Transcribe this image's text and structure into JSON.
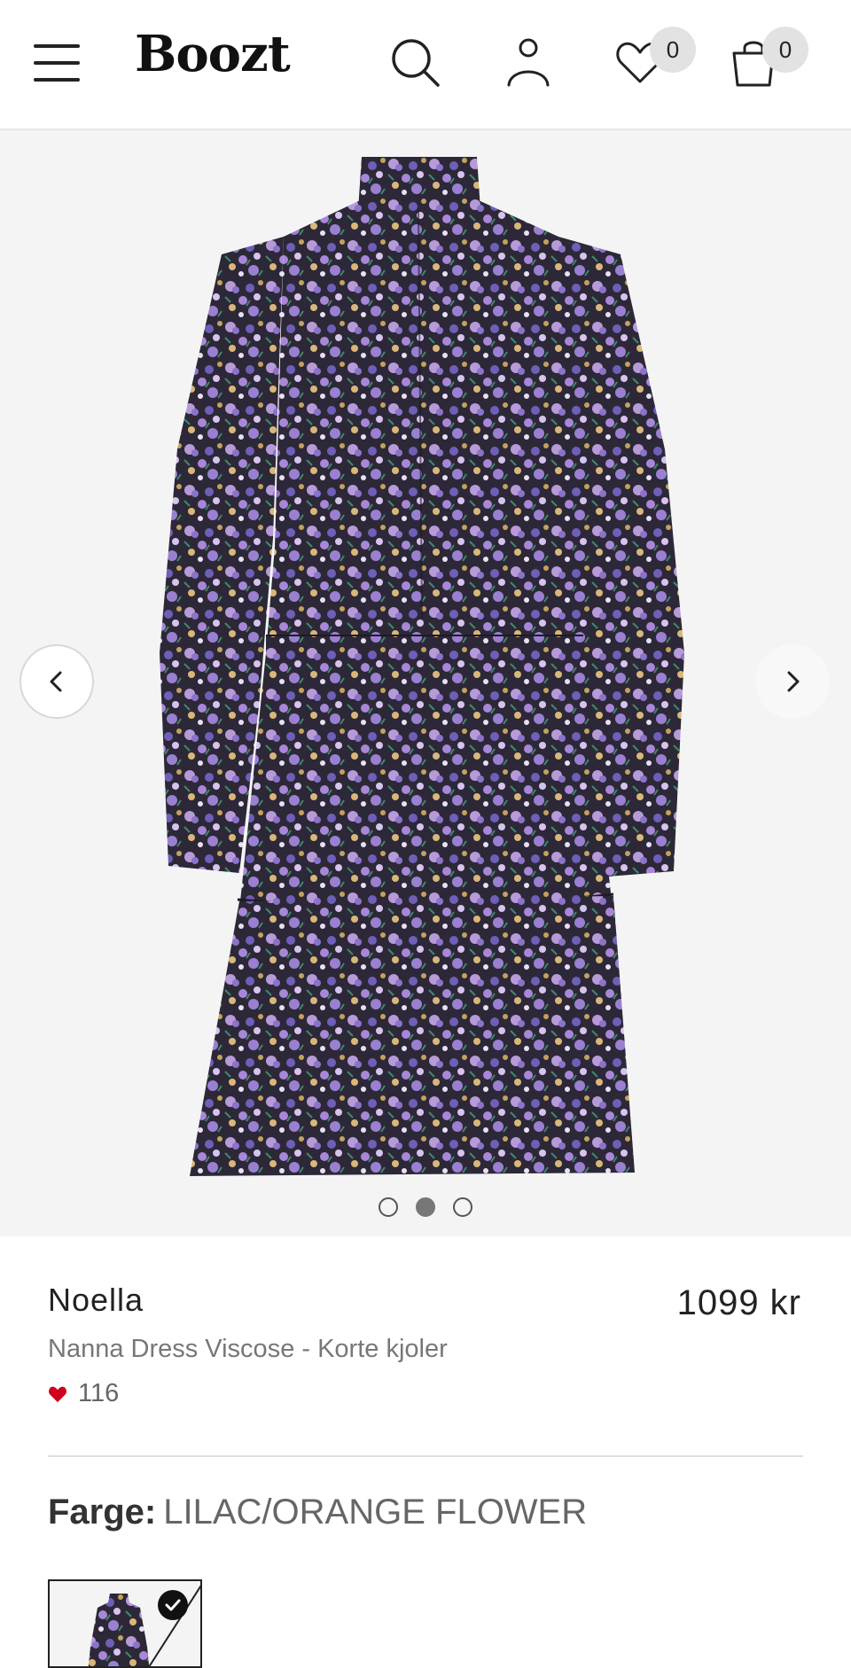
{
  "header": {
    "logo": "Boozt",
    "wishlist_count": "0",
    "cart_count": "0",
    "icons": [
      "menu-icon",
      "search-icon",
      "user-icon",
      "heart-icon",
      "bag-icon"
    ]
  },
  "gallery": {
    "image_alt": "Nanna Dress Viscose - lilac/orange flower print",
    "total_images": 3,
    "active_index": 1,
    "colors": {
      "background": "#f4f4f4",
      "print_purple": "#7a62b8",
      "print_lilac": "#b79ad8",
      "print_dark": "#2a2535"
    }
  },
  "product": {
    "brand": "Noella",
    "price": "1099 kr",
    "name": "Nanna Dress Viscose - Korte kjoler",
    "likes": "116",
    "like_color": "#d0021b"
  },
  "color_selector": {
    "label": "Farge:",
    "value": "LILAC/ORANGE FLOWER"
  }
}
